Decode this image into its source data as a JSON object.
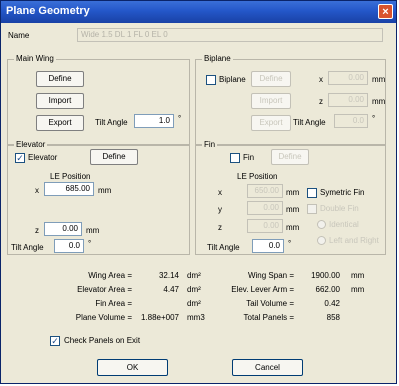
{
  "window": {
    "title": "Plane Geometry",
    "close_glyph": "×"
  },
  "name": {
    "label": "Name",
    "value": "Wide 1.5 DL 1 FL 0 EL 0"
  },
  "main_wing": {
    "title": "Main Wing",
    "define": "Define",
    "import": "Import",
    "export": "Export",
    "tilt_label": "Tilt Angle",
    "tilt_value": "1.0",
    "tilt_unit": "°"
  },
  "biplane": {
    "title": "Biplane",
    "check_label": "Biplane",
    "checked": false,
    "define": "Define",
    "import": "Import",
    "export": "Export",
    "x_label": "x",
    "x_value": "0.00",
    "x_unit": "mm",
    "z_label": "z",
    "z_value": "0.00",
    "z_unit": "mm",
    "tilt_label": "Tilt Angle",
    "tilt_value": "0.0",
    "tilt_unit": "°"
  },
  "elevator": {
    "title": "Elevator",
    "check_label": "Elevator",
    "checked": true,
    "define": "Define",
    "le_position": "LE Position",
    "x_label": "x",
    "x_value": "685.00",
    "x_unit": "mm",
    "z_label": "z",
    "z_value": "0.00",
    "z_unit": "mm",
    "tilt_label": "Tilt Angle",
    "tilt_value": "0.0",
    "tilt_unit": "°"
  },
  "fin": {
    "title": "Fin",
    "check_label": "Fin",
    "checked": false,
    "define": "Define",
    "le_position": "LE Position",
    "x_label": "x",
    "x_value": "650.00",
    "x_unit": "mm",
    "y_label": "y",
    "y_value": "0.00",
    "y_unit": "mm",
    "z_label": "z",
    "z_value": "0.00",
    "z_unit": "mm",
    "symetric": "Symetric Fin",
    "double": "Double Fin",
    "identical": "Identical",
    "left_right": "Left and Right",
    "tilt_label": "Tilt Angle",
    "tilt_value": "0.0",
    "tilt_unit": "°"
  },
  "stats": {
    "wing_area_label": "Wing Area =",
    "wing_area_value": "32.14",
    "wing_area_unit": "dm²",
    "elevator_area_label": "Elevator Area =",
    "elevator_area_value": "4.47",
    "elevator_area_unit": "dm²",
    "fin_area_label": "Fin Area =",
    "fin_area_value": "",
    "fin_area_unit": "dm²",
    "plane_volume_label": "Plane Volume =",
    "plane_volume_value": "1.88e+007",
    "plane_volume_unit": "mm3",
    "wing_span_label": "Wing Span =",
    "wing_span_value": "1900.00",
    "wing_span_unit": "mm",
    "lever_arm_label": "Elev. Lever Arm =",
    "lever_arm_value": "662.00",
    "lever_arm_unit": "mm",
    "tail_volume_label": "Tail Volume =",
    "tail_volume_value": "0.42",
    "total_panels_label": "Total Panels =",
    "total_panels_value": "858"
  },
  "check_panels": {
    "label": "Check Panels on Exit",
    "checked": true
  },
  "buttons": {
    "ok": "OK",
    "cancel": "Cancel"
  }
}
